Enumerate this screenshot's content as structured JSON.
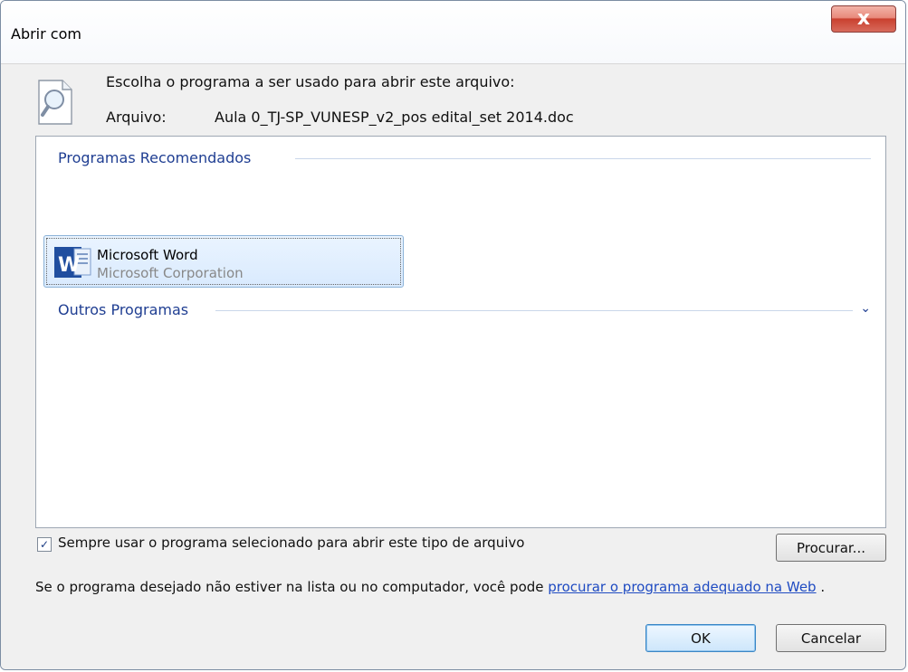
{
  "window": {
    "title": "Abrir com",
    "close_label": "x"
  },
  "header": {
    "prompt": "Escolha o programa a ser usado para abrir este arquivo:",
    "file_label": "Arquivo:",
    "file_name": "Aula 0_TJ-SP_VUNESP_v2_pos edital_set 2014.doc"
  },
  "programs": {
    "recommended_label": "Programas Recomendados",
    "items": [
      {
        "name": "Microsoft Word",
        "company": "Microsoft Corporation"
      }
    ],
    "other_label": "Outros Programas"
  },
  "options": {
    "always_use_label": "Sempre usar o programa selecionado para abrir este tipo de arquivo",
    "always_use_checked": true,
    "browse_label": "Procurar..."
  },
  "footer": {
    "text_prefix": "Se o programa desejado não estiver na lista ou no computador, você pode ",
    "link_text": "procurar o programa adequado na Web",
    "text_suffix": "."
  },
  "buttons": {
    "ok_label": "OK",
    "cancel_label": "Cancelar"
  },
  "colors": {
    "accent": "#1f3e92",
    "selection": "#d9eafe",
    "link": "#1f4bc2",
    "close": "#c9402f"
  },
  "icons": {
    "file": "magnifier-file-icon",
    "program": "microsoft-word-icon",
    "expand": "chevron-down-icon",
    "checkbox": "check-icon"
  }
}
